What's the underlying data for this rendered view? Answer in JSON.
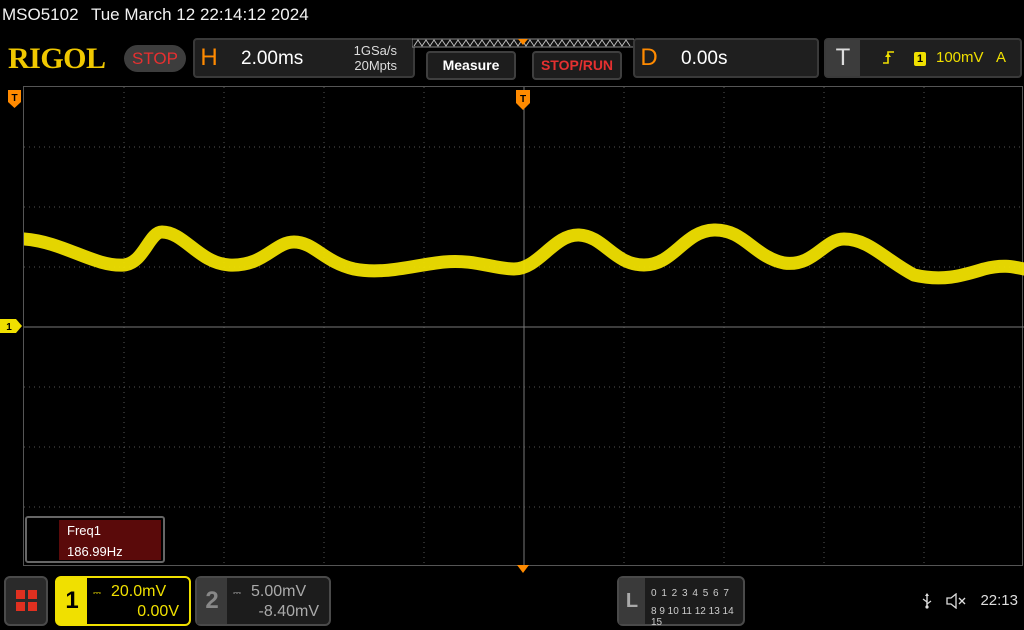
{
  "header": {
    "model": "MSO5102",
    "datetime": "Tue March 12 22:14:12 2024"
  },
  "brand": "RIGOL",
  "run_state": "STOP",
  "horizontal": {
    "letter": "H",
    "timebase": "2.00ms",
    "sample_rate": "1GSa/s",
    "memory_depth": "20Mpts"
  },
  "buttons": {
    "measure": "Measure",
    "stop_run": "STOP/RUN"
  },
  "delay": {
    "letter": "D",
    "value": "0.00s"
  },
  "trigger": {
    "letter": "T",
    "edge_icon": "rising-edge-icon",
    "channel": "1",
    "level": "100mV",
    "mode": "A"
  },
  "markers": {
    "trigger_marker": "T",
    "ch1_marker": "1"
  },
  "measurement": {
    "label": "Freq1",
    "value": "186.99Hz"
  },
  "channels": [
    {
      "number": "1",
      "scale": "20.0mV",
      "offset": "0.00V",
      "color": "#f0e000"
    },
    {
      "number": "2",
      "scale": "5.00mV",
      "offset": "-8.40mV",
      "color": "#aaaaaa"
    }
  ],
  "logic": {
    "letter": "L",
    "row1": "0 1 2 3  4 5 6 7",
    "row2": "8 9 10 11 12 13 14 15"
  },
  "status": {
    "usb_icon": "usb-icon",
    "mute_icon": "speaker-muted-icon",
    "time": "22:13"
  },
  "colors": {
    "trace": "#f0e000",
    "accent": "#ff8a00",
    "stop": "#e53030"
  }
}
